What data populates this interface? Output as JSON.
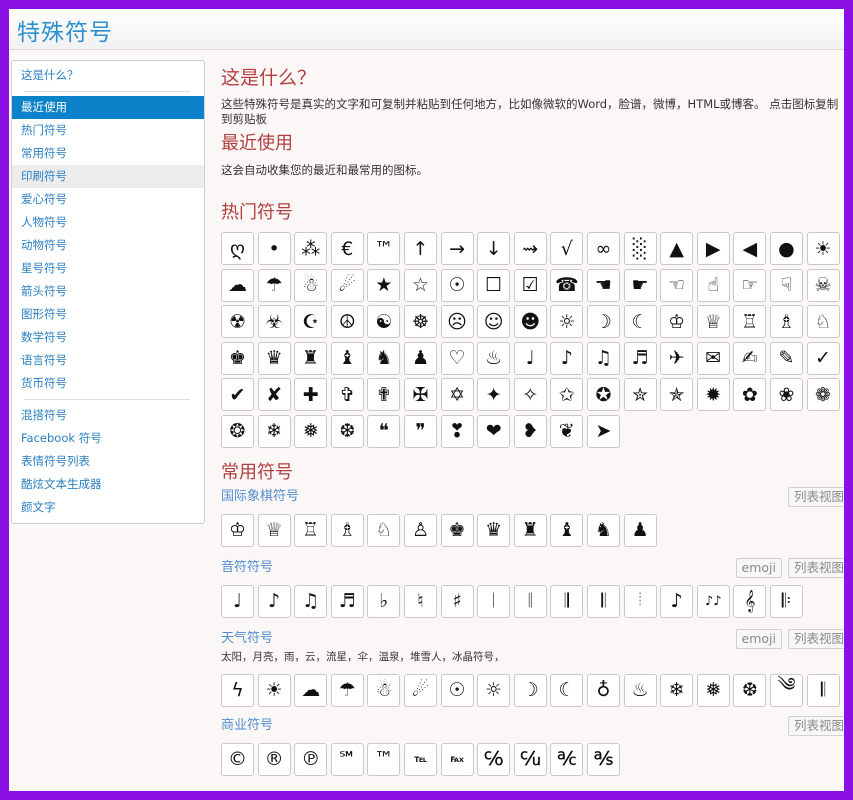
{
  "header": {
    "brand": "特殊符号"
  },
  "sidebar": {
    "about": "这是什么？",
    "items": [
      "最近使用",
      "热门符号",
      "常用符号",
      "印刷符号",
      "爱心符号",
      "人物符号",
      "动物符号",
      "星号符号",
      "箭头符号",
      "图形符号",
      "数学符号",
      "语言符号",
      "货币符号"
    ],
    "extras": [
      "混搭符号",
      "Facebook 符号",
      "表情符号列表",
      "酷炫文本生成器",
      "颜文字"
    ]
  },
  "about": {
    "title": "这是什么？",
    "text": "这些特殊符号是真实的文字和可复制并粘贴到任何地方，比如像微软的Word，脸谱，微博，HTML或博客。 点击图标复制到剪贴板"
  },
  "recent": {
    "title": "最近使用",
    "text": "这会自动收集您的最近和最常用的图标。"
  },
  "hot": {
    "title": "热门符号",
    "symbols": [
      "ღ",
      "•",
      "⁂",
      "€",
      "™",
      "↑",
      "→",
      "↓",
      "⇝",
      "√",
      "∞",
      "░",
      "▲",
      "▶",
      "◀",
      "●",
      "☀",
      "☁",
      "☂",
      "☃",
      "☄",
      "★",
      "☆",
      "☉",
      "☐",
      "☑",
      "☎",
      "☚",
      "☛",
      "☜",
      "☝",
      "☞",
      "☟",
      "☠",
      "☢",
      "☣",
      "☪",
      "☮",
      "☯",
      "☸",
      "☹",
      "☺",
      "☻",
      "☼",
      "☽",
      "☾",
      "♔",
      "♕",
      "♖",
      "♗",
      "♘",
      "♚",
      "♛",
      "♜",
      "♝",
      "♞",
      "♟",
      "♡",
      "♨",
      "♩",
      "♪",
      "♫",
      "♬",
      "✈",
      "✉",
      "✍",
      "✎",
      "✓",
      "✔",
      "✘",
      "✚",
      "✞",
      "✟",
      "✠",
      "✡",
      "✦",
      "✧",
      "✩",
      "✪",
      "✮",
      "✯",
      "✹",
      "✿",
      "❀",
      "❁",
      "❂",
      "❄",
      "❅",
      "❆",
      "❝",
      "❞",
      "❣",
      "❤",
      "❥",
      "❦",
      "➤"
    ]
  },
  "common": {
    "title": "常用符号",
    "chess": {
      "title": "国际象棋符号",
      "list_label": "列表视图",
      "symbols": [
        "♔",
        "♕",
        "♖",
        "♗",
        "♘",
        "♙",
        "♚",
        "♛",
        "♜",
        "♝",
        "♞",
        "♟"
      ]
    },
    "music": {
      "title": "音符符号",
      "emoji_label": "emoji",
      "list_label": "列表视图",
      "symbols": [
        "♩",
        "♪",
        "♫",
        "♬",
        "♭",
        "♮",
        "♯",
        "𝄀",
        "𝄁",
        "𝄂",
        "𝄃",
        "𝄄",
        "♪",
        "♪♪",
        "𝄞",
        "𝄆"
      ]
    },
    "weather": {
      "title": "天气符号",
      "emoji_label": "emoji",
      "list_label": "列表视图",
      "desc": "太阳，月亮，雨，云，流星，伞，温泉，堆雪人，冰晶符号，",
      "symbols": [
        "ϟ",
        "☀",
        "☁",
        "☂",
        "☃",
        "☄",
        "☉",
        "☼",
        "☽",
        "☾",
        "♁",
        "♨",
        "❄",
        "❅",
        "❆",
        "༄",
        "𝄃"
      ]
    },
    "business": {
      "title": "商业符号",
      "list_label": "列表视图",
      "symbols": [
        "©",
        "®",
        "℗",
        "℠",
        "™",
        "℡",
        "℻",
        "℅",
        "℆",
        "℀",
        "℁"
      ]
    }
  }
}
